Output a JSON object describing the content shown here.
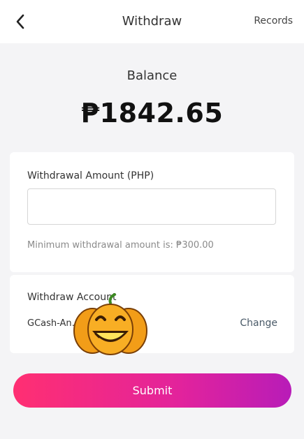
{
  "header": {
    "title": "Withdraw",
    "records_label": "Records",
    "back_icon": "chevron-left-icon"
  },
  "balance": {
    "label": "Balance",
    "value": "₱1842.65"
  },
  "amount": {
    "label": "Withdrawal Amount (PHP)",
    "input_value": "",
    "placeholder": "",
    "min_note": "Minimum withdrawal amount is: ₱300.00"
  },
  "account": {
    "label": "Withdraw Account",
    "value": "GCash-An…on -***2264",
    "change_label": "Change"
  },
  "sticker": {
    "icon": "pumpkin-sticker-icon"
  },
  "submit": {
    "label": "Submit"
  },
  "colors": {
    "gradient_start": "#ff2f72",
    "gradient_end": "#b81cb8",
    "pumpkin": "#f7a21b"
  }
}
